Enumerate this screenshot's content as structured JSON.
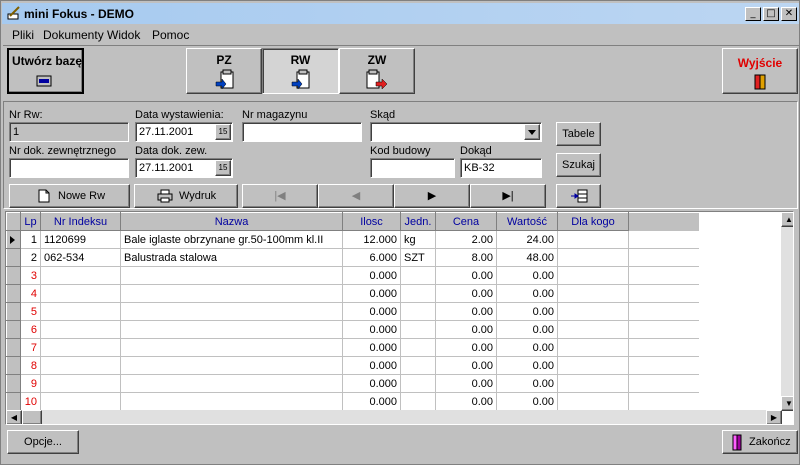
{
  "window": {
    "title": "mini Fokus - DEMO",
    "min": "_",
    "max": "□",
    "close": "✕"
  },
  "menu": [
    "Pliki",
    "Dokumenty",
    "Widok",
    "Pomoc"
  ],
  "toolbar": {
    "create_db": "Utwórz bazę",
    "pz": "PZ",
    "rw": "RW",
    "zw": "ZW",
    "exit": "Wyjście"
  },
  "form": {
    "nr_rw_label": "Nr Rw:",
    "nr_rw_value": "1",
    "data_wyst_label": "Data wystawienia:",
    "data_wyst_value": "27.11.2001",
    "nr_mag_label": "Nr magazynu",
    "nr_mag_value": "",
    "skad_label": "Skąd",
    "skad_value": "",
    "tabele": "Tabele",
    "nr_dok_label": "Nr dok. zewnętrznego",
    "nr_dok_value": "",
    "data_dok_label": "Data dok. zew.",
    "data_dok_value": "27.11.2001",
    "kod_label": "Kod budowy",
    "kod_value": "",
    "dokad_label": "Dokąd",
    "dokad_value": "KB-32",
    "szukaj": "Szukaj",
    "cal_glyph": "15"
  },
  "actions": {
    "new": "Nowe Rw",
    "print": "Wydruk",
    "first": "|◀",
    "prev": "◀",
    "next": "▶",
    "last": "▶|"
  },
  "grid": {
    "headers": [
      "Lp",
      "Nr Indeksu",
      "Nazwa",
      "Ilosc",
      "Jedn.",
      "Cena",
      "Wartość",
      "Dla kogo"
    ],
    "rows": [
      [
        "1",
        "1120699",
        "Bale iglaste obrzynane gr.50-100mm kl.II",
        "12.000",
        "kg",
        "2.00",
        "24.00",
        ""
      ],
      [
        "2",
        "062-534",
        "Balustrada stalowa",
        "6.000",
        "SZT",
        "8.00",
        "48.00",
        ""
      ],
      [
        "3",
        "",
        "",
        "0.000",
        "",
        "0.00",
        "0.00",
        ""
      ],
      [
        "4",
        "",
        "",
        "0.000",
        "",
        "0.00",
        "0.00",
        ""
      ],
      [
        "5",
        "",
        "",
        "0.000",
        "",
        "0.00",
        "0.00",
        ""
      ],
      [
        "6",
        "",
        "",
        "0.000",
        "",
        "0.00",
        "0.00",
        ""
      ],
      [
        "7",
        "",
        "",
        "0.000",
        "",
        "0.00",
        "0.00",
        ""
      ],
      [
        "8",
        "",
        "",
        "0.000",
        "",
        "0.00",
        "0.00",
        ""
      ],
      [
        "9",
        "",
        "",
        "0.000",
        "",
        "0.00",
        "0.00",
        ""
      ],
      [
        "10",
        "",
        "",
        "0.000",
        "",
        "0.00",
        "0.00",
        ""
      ]
    ]
  },
  "status": {
    "options": "Opcje...",
    "close": "Zakończ"
  }
}
